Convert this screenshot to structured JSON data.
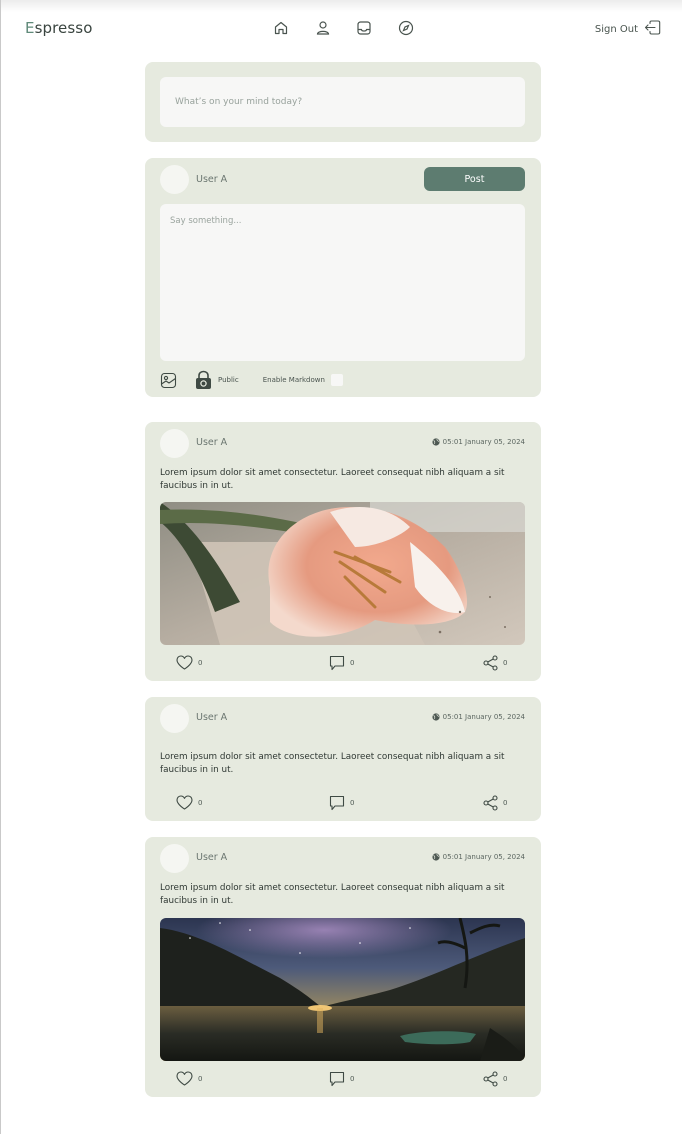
{
  "app": {
    "logo_first_letter": "E",
    "logo_rest": "spresso",
    "sign_out_label": "Sign Out"
  },
  "nav": {
    "icons": [
      "home-icon",
      "profile-icon",
      "inbox-icon",
      "explore-compass-icon"
    ]
  },
  "status_prompt": {
    "placeholder": "What’s on your mind today?"
  },
  "composer": {
    "user_name": "User A",
    "post_label": "Post",
    "placeholder": "Say something...",
    "visibility_label": "Public",
    "markdown_label": "Enable Markdown"
  },
  "posts": [
    {
      "user_name": "User A",
      "timestamp": "05:01 January 05, 2024",
      "text": "Lorem ipsum dolor sit amet consectetur. Laoreet consequat nibh aliquam a sit faucibus in in ut.",
      "image": "peach-tulip-photo",
      "likes": "0",
      "comments": "0",
      "shares": "0"
    },
    {
      "user_name": "User A",
      "timestamp": "05:01 January 05, 2024",
      "text": "Lorem ipsum dolor sit amet consectetur. Laoreet consequat nibh aliquam a sit faucibus in in ut.",
      "likes": "0",
      "comments": "0",
      "shares": "0"
    },
    {
      "user_name": "User A",
      "timestamp": "05:01 January 05, 2024",
      "text": "Lorem ipsum dolor sit amet consectetur. Laoreet consequat nibh aliquam a sit faucibus in in ut.",
      "image": "night-lake-milky-way-photo",
      "likes": "0",
      "comments": "0",
      "shares": "0"
    }
  ],
  "colors": {
    "accent": "#5d7c70",
    "card_background": "#e6eadf",
    "input_background": "#f7f7f6"
  }
}
